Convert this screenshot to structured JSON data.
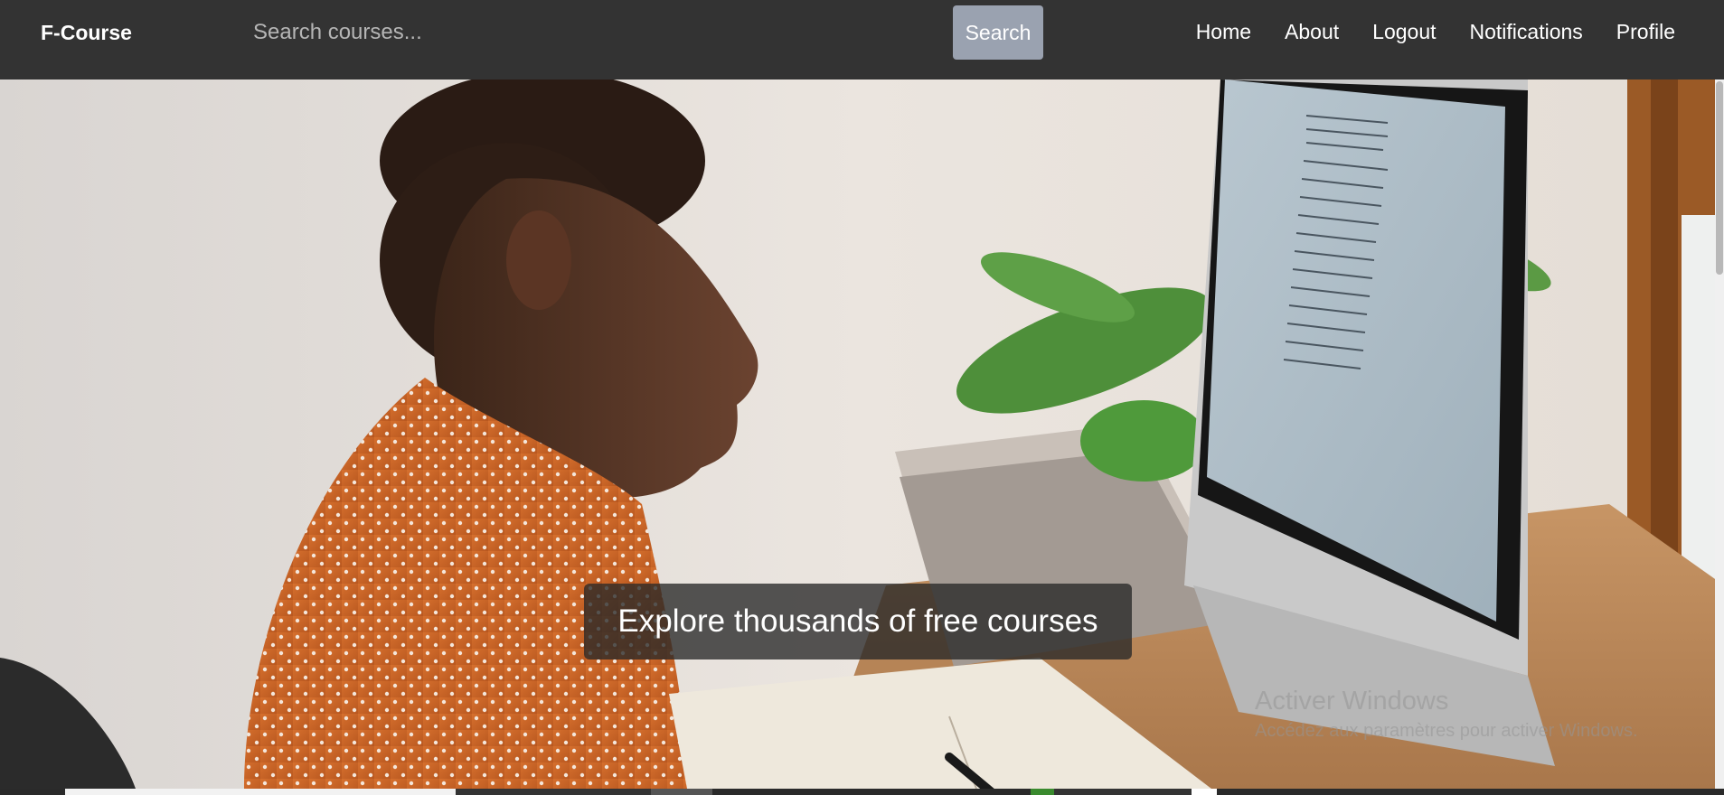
{
  "navbar": {
    "brand": "F-Course",
    "search_placeholder": "Search courses...",
    "search_label": "Search",
    "links": [
      "Home",
      "About",
      "Logout",
      "Notifications",
      "Profile"
    ]
  },
  "hero": {
    "caption": "Explore thousands of free courses"
  },
  "watermark": {
    "title": "Activer Windows",
    "subtitle": "Accédez aux paramètres pour activer Windows."
  },
  "colors": {
    "navbar_bg": "#333333",
    "search_button_bg": "#9aa2b0",
    "caption_bg": "#282828"
  }
}
